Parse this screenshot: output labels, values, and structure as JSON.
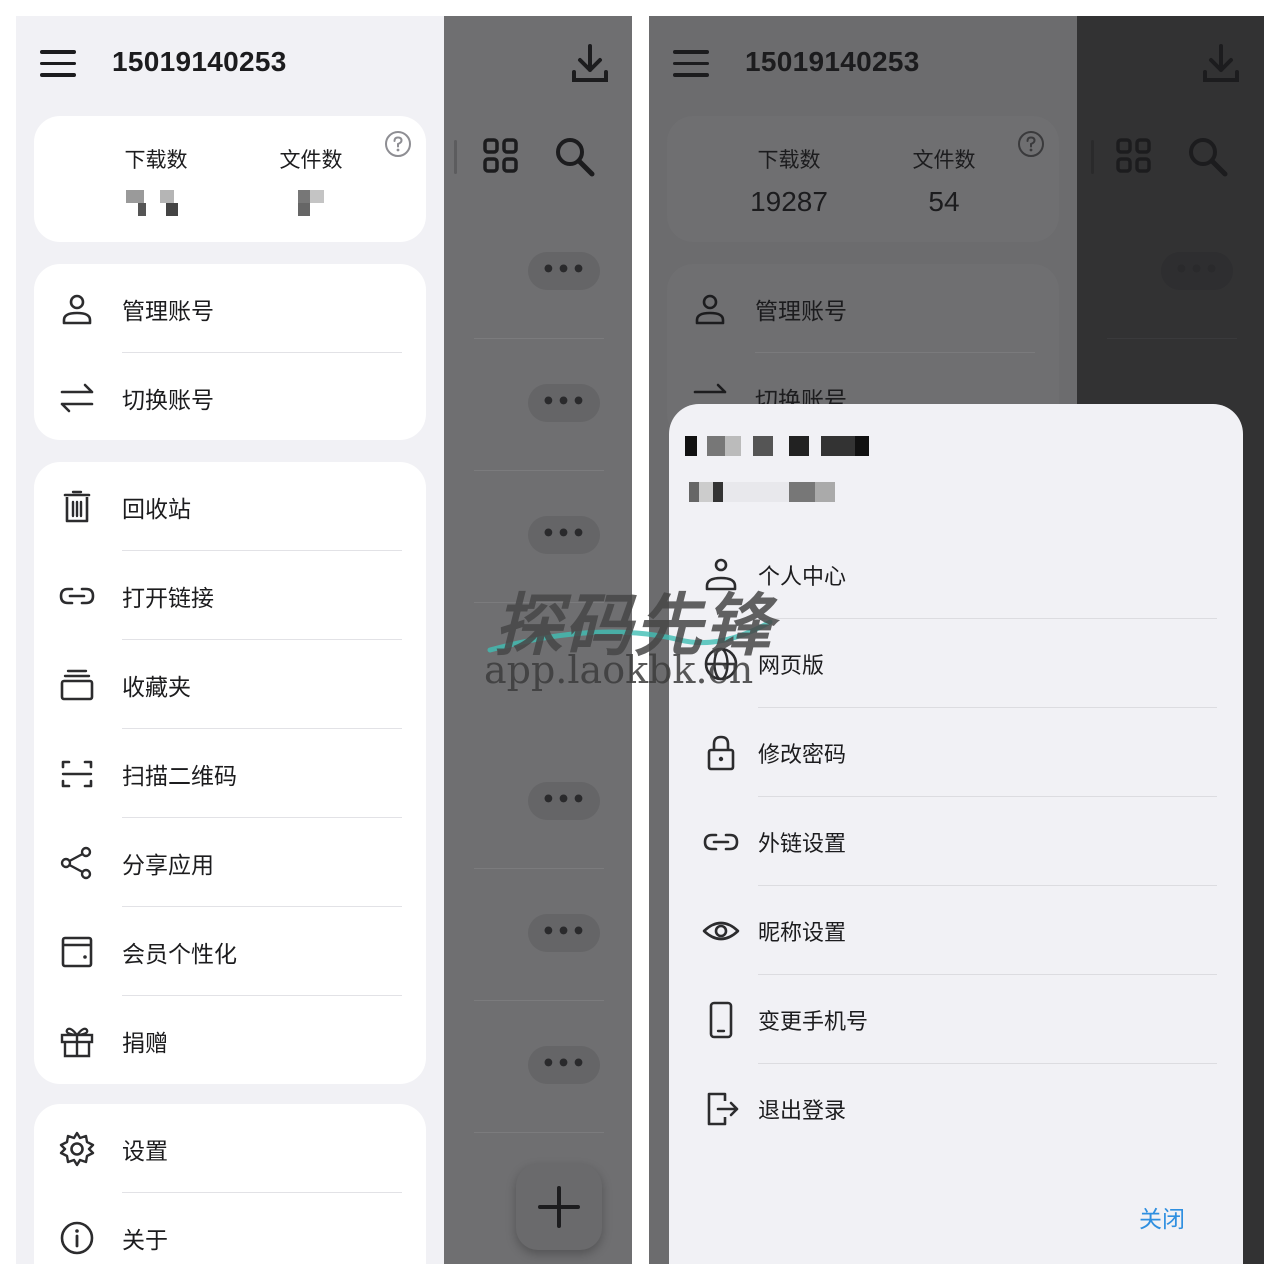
{
  "left": {
    "account_title": "15019140253",
    "stats": {
      "downloads_label": "下载数",
      "files_label": "文件数"
    },
    "group1": [
      {
        "label": "管理账号",
        "icon": "person-icon"
      },
      {
        "label": "切换账号",
        "icon": "swap-icon"
      }
    ],
    "group2": [
      {
        "label": "回收站",
        "icon": "trash-icon"
      },
      {
        "label": "打开链接",
        "icon": "link-icon"
      },
      {
        "label": "收藏夹",
        "icon": "collection-icon"
      },
      {
        "label": "扫描二维码",
        "icon": "scan-icon"
      },
      {
        "label": "分享应用",
        "icon": "share-icon"
      },
      {
        "label": "会员个性化",
        "icon": "wallet-icon"
      },
      {
        "label": "捐赠",
        "icon": "gift-icon"
      }
    ],
    "group3": [
      {
        "label": "设置",
        "icon": "gear-icon"
      },
      {
        "label": "关于",
        "icon": "info-icon"
      }
    ]
  },
  "right": {
    "account_title": "15019140253",
    "stats": {
      "downloads_label": "下载数",
      "downloads_value": "19287",
      "files_label": "文件数",
      "files_value": "54"
    },
    "group1_visible": [
      {
        "label": "管理账号",
        "icon": "person-icon"
      },
      {
        "label": "切换账号",
        "icon": "swap-icon"
      }
    ],
    "sheet": {
      "items": [
        {
          "label": "个人中心",
          "icon": "person-icon"
        },
        {
          "label": "网页版",
          "icon": "globe-icon"
        },
        {
          "label": "修改密码",
          "icon": "lock-icon"
        },
        {
          "label": "外链设置",
          "icon": "link-icon"
        },
        {
          "label": "昵称设置",
          "icon": "eye-icon"
        },
        {
          "label": "变更手机号",
          "icon": "phone-icon"
        },
        {
          "label": "退出登录",
          "icon": "logout-icon"
        }
      ],
      "close_label": "关闭"
    }
  },
  "watermark": {
    "title": "探码先锋",
    "url": "app.laokbk.cn"
  },
  "colors": {
    "accent": "#2f8fe0",
    "drawer_bg": "#f1f1f5",
    "scrim": "#6f6f71"
  }
}
